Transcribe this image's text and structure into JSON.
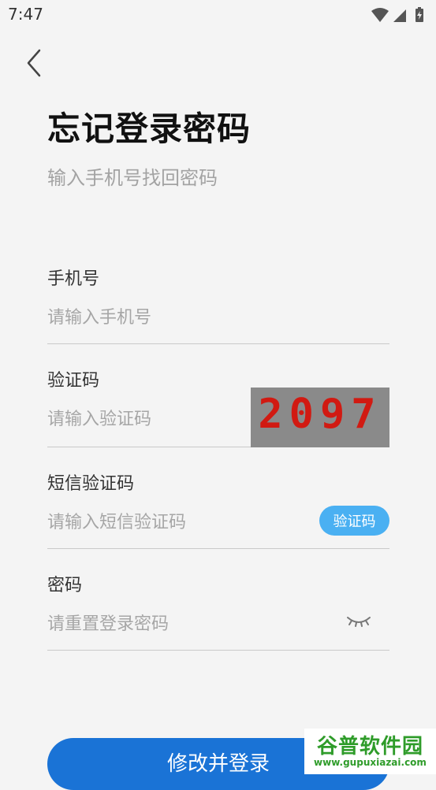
{
  "status_bar": {
    "time": "7:47",
    "icons": [
      "wifi-icon",
      "signal-icon",
      "battery-icon"
    ]
  },
  "header": {
    "back_icon": "chevron-left-icon"
  },
  "title": "忘记登录密码",
  "subtitle": "输入手机号找回密码",
  "fields": {
    "phone": {
      "label": "手机号",
      "placeholder": "请输入手机号",
      "value": ""
    },
    "captcha": {
      "label": "验证码",
      "placeholder": "请输入验证码",
      "value": "",
      "captcha_code": "2097"
    },
    "sms": {
      "label": "短信验证码",
      "placeholder": "请输入短信验证码",
      "value": "",
      "button_label": "验证码"
    },
    "password": {
      "label": "密码",
      "placeholder": "请重置登录密码",
      "value": "",
      "toggle_icon": "eye-closed-icon"
    }
  },
  "submit_label": "修改并登录",
  "watermark": {
    "title": "谷普软件园",
    "url": "www.gupuxiazai.com"
  },
  "colors": {
    "primary": "#1a73d6",
    "code_button": "#4ab0f2",
    "captcha_bg": "#8a8a8a",
    "captcha_text": "#d11a12",
    "placeholder": "#a6a6a6",
    "watermark_green": "#2f9c2a"
  }
}
